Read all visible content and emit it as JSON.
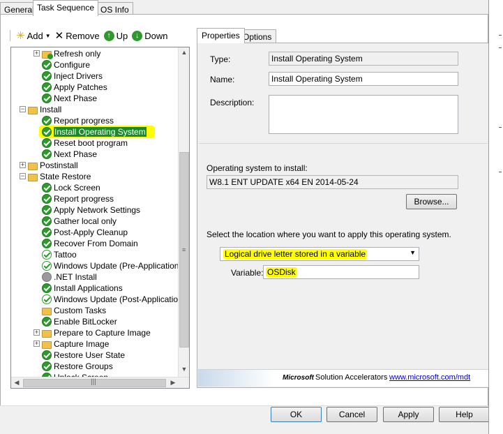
{
  "tabs": [
    {
      "label": "General"
    },
    {
      "label": "Task Sequence",
      "active": true
    },
    {
      "label": "OS Info"
    }
  ],
  "toolbar": {
    "add_label": "Add",
    "remove_label": "Remove",
    "up_label": "Up",
    "down_label": "Down"
  },
  "tree": [
    {
      "label": "Refresh only",
      "icon": "folder-check-icon",
      "expander": "+"
    },
    {
      "label": "Configure",
      "icon": "check-icon"
    },
    {
      "label": "Inject Drivers",
      "icon": "check-icon"
    },
    {
      "label": "Apply Patches",
      "icon": "check-icon"
    },
    {
      "label": "Next Phase",
      "icon": "check-icon"
    },
    {
      "label": "Install",
      "icon": "folder-icon",
      "expander": "−"
    },
    {
      "label": "Report progress",
      "icon": "check-icon"
    },
    {
      "label": "Install Operating System",
      "icon": "check-icon",
      "selected": true
    },
    {
      "label": "Reset boot program",
      "icon": "check-icon"
    },
    {
      "label": "Next Phase",
      "icon": "check-icon"
    },
    {
      "label": "Postinstall",
      "icon": "folder-icon",
      "expander": "+"
    },
    {
      "label": "State Restore",
      "icon": "folder-icon",
      "expander": "−"
    },
    {
      "label": "Lock Screen",
      "icon": "check-icon"
    },
    {
      "label": "Report progress",
      "icon": "check-icon"
    },
    {
      "label": "Apply Network Settings",
      "icon": "check-icon"
    },
    {
      "label": "Gather local only",
      "icon": "check-icon"
    },
    {
      "label": "Post-Apply Cleanup",
      "icon": "check-icon"
    },
    {
      "label": "Recover From Domain",
      "icon": "check-icon"
    },
    {
      "label": "Tattoo",
      "icon": "check-outline-icon"
    },
    {
      "label": "Windows Update (Pre-Application Inst",
      "icon": "check-outline-icon"
    },
    {
      "label": ".NET Install",
      "icon": "disabled-icon"
    },
    {
      "label": "Install Applications",
      "icon": "check-icon"
    },
    {
      "label": "Windows Update (Post-Application Ins",
      "icon": "check-outline-icon"
    },
    {
      "label": "Custom Tasks",
      "icon": "folder-icon"
    },
    {
      "label": "Enable BitLocker",
      "icon": "check-icon"
    },
    {
      "label": "Prepare to Capture Image",
      "icon": "folder-icon",
      "expander": "+"
    },
    {
      "label": "Capture Image",
      "icon": "folder-icon",
      "expander": "+"
    },
    {
      "label": "Restore User State",
      "icon": "check-icon"
    },
    {
      "label": "Restore Groups",
      "icon": "check-icon"
    },
    {
      "label": "Unlock Screen",
      "icon": "check-icon"
    }
  ],
  "props_tabs": [
    {
      "label": "Properties",
      "active": true
    },
    {
      "label": "Options"
    }
  ],
  "props": {
    "type_label": "Type:",
    "type_value": "Install Operating System",
    "name_label": "Name:",
    "name_value": "Install Operating System",
    "description_label": "Description:",
    "description_value": "",
    "os_label": "Operating system to install:",
    "os_value": "W8.1 ENT UPDATE x64 EN 2014-05-24",
    "browse_label": "Browse...",
    "location_label": "Select the location where you want to apply this operating system.",
    "location_value": "Logical drive letter stored in a variable",
    "variable_label": "Variable:",
    "variable_value": "OSDisk"
  },
  "footer": {
    "brand": "Microsoft",
    "product": "Solution Accelerators",
    "link": "www.microsoft.com/mdt"
  },
  "dialog_buttons": {
    "ok": "OK",
    "cancel": "Cancel",
    "apply": "Apply",
    "help": "Help"
  },
  "colors": {
    "highlight": "#ffff00",
    "selection": "#1a8a2a",
    "check": "#2d9a2d"
  }
}
